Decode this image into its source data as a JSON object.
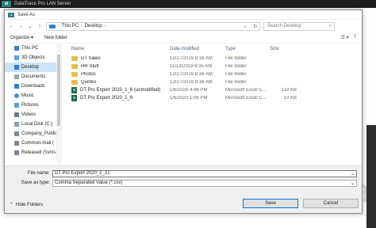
{
  "app": {
    "title": "DataTrace Pro LAN Server",
    "logo": "dt",
    "watermark": "a"
  },
  "dialog": {
    "title": "Save As",
    "address": {
      "crumbs": [
        "This PC",
        "Desktop"
      ]
    },
    "search_placeholder": "Search Desktop",
    "toolbar": {
      "organize": "Organize ▾",
      "new_folder": "New folder",
      "view_icon": "☰ ▾",
      "help": "?"
    },
    "nav": [
      {
        "label": "This PC",
        "icon": "pc-icon"
      },
      {
        "label": "3D Objects",
        "icon": "cube-icon"
      },
      {
        "label": "Desktop",
        "icon": "desktop-icon",
        "selected": true
      },
      {
        "label": "Documents",
        "icon": "documents-icon"
      },
      {
        "label": "Downloads",
        "icon": "downloads-icon"
      },
      {
        "label": "Music",
        "icon": "music-icon"
      },
      {
        "label": "Pictures",
        "icon": "pictures-icon"
      },
      {
        "label": "Videos",
        "icon": "videos-icon"
      },
      {
        "label": "Local Disk (C:)",
        "icon": "disk-icon"
      },
      {
        "label": "Company_Public",
        "icon": "network-drive-icon"
      },
      {
        "label": "Common-mail (",
        "icon": "network-drive-icon"
      },
      {
        "label": "Released (\\\\vms",
        "icon": "network-drive-icon"
      }
    ],
    "columns": {
      "name": "Name",
      "date": "Date modified",
      "type": "Type",
      "size": "Size"
    },
    "files": [
      {
        "name": "DT Sales",
        "date": "12/27/2019 8:16 AM",
        "type": "File folder",
        "size": "",
        "icon": "folder-icon"
      },
      {
        "name": "HR Stuff",
        "date": "11/19/2019 6:35 AM",
        "type": "File folder",
        "size": "",
        "icon": "folder-icon"
      },
      {
        "name": "Photos",
        "date": "12/27/2019 8:16 AM",
        "type": "File folder",
        "size": "",
        "icon": "folder-icon"
      },
      {
        "name": "Quotes",
        "date": "12/27/2019 8:16 AM",
        "type": "File folder",
        "size": "",
        "icon": "folder-icon"
      },
      {
        "name": "DT Pro Export 2020_1_6 (unmodified)",
        "date": "1/6/2020 4:46 PM",
        "type": "Microsoft Excel C...",
        "size": "119 KB",
        "icon": "excel-icon"
      },
      {
        "name": "DT Pro Export 2020_1_6",
        "date": "1/6/2020 1:06 PM",
        "type": "Microsoft Excel C...",
        "size": "13 KB",
        "icon": "excel-icon"
      }
    ],
    "file_name_label": "File name:",
    "file_name_value": "DT Pro Export 2020_1_21",
    "save_type_label": "Save as type:",
    "save_type_value": "Comma Separated Value (*.csv)",
    "hide_folders": "Hide Folders",
    "save_button": "Save",
    "cancel_button": "Cancel"
  }
}
